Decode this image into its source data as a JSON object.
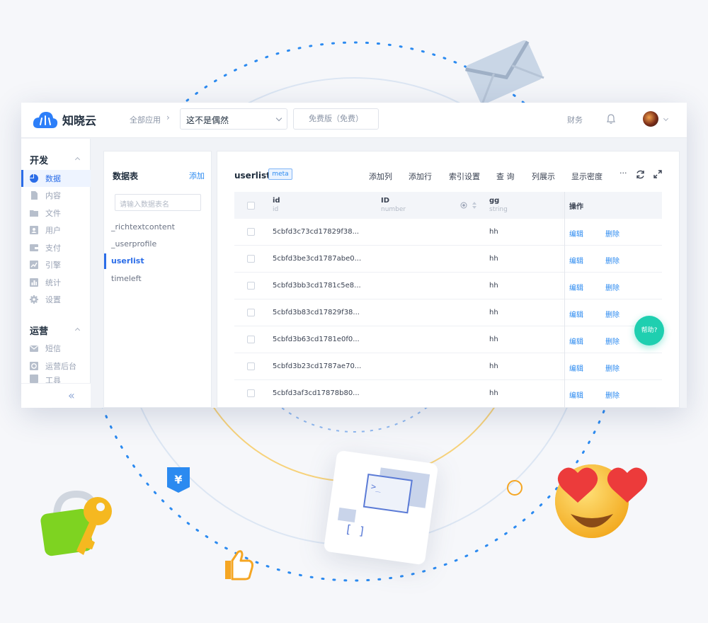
{
  "app": {
    "name": "知晓云"
  },
  "header": {
    "breadcrumb": "全部应用",
    "app_select": "这不是偶然",
    "plan": "免费版（免费）",
    "finance": "财务"
  },
  "sidebar": {
    "groups": [
      {
        "label": "开发",
        "items": [
          {
            "label": "数据",
            "active": true,
            "icon": "pie-chart-icon"
          },
          {
            "label": "内容",
            "icon": "document-icon"
          },
          {
            "label": "文件",
            "icon": "folder-icon"
          },
          {
            "label": "用户",
            "icon": "user-card-icon"
          },
          {
            "label": "支付",
            "icon": "wallet-icon"
          },
          {
            "label": "引擎",
            "icon": "trend-chart-icon"
          },
          {
            "label": "统计",
            "icon": "bar-chart-icon"
          },
          {
            "label": "设置",
            "icon": "gear-icon"
          }
        ]
      },
      {
        "label": "运营",
        "items": [
          {
            "label": "短信",
            "icon": "mail-icon"
          },
          {
            "label": "运营后台",
            "icon": "dashboard-icon"
          },
          {
            "label": "工具",
            "icon": "tool-icon"
          }
        ]
      }
    ],
    "collapse": "«"
  },
  "tables_panel": {
    "title": "数据表",
    "add": "添加",
    "search_placeholder": "请输入数据表名",
    "items": [
      "_richtextcontent",
      "_userprofile",
      "userlist",
      "timeleft"
    ],
    "active": "userlist"
  },
  "main": {
    "title": "userlist",
    "tag": "meta",
    "toolbar": [
      "添加列",
      "添加行",
      "索引设置",
      "查 询",
      "列展示",
      "显示密度"
    ],
    "more": "···",
    "columns": [
      {
        "name": "id",
        "sub": "id"
      },
      {
        "name": "ID",
        "sub": "number"
      },
      {
        "name": "gg",
        "sub": "string"
      },
      {
        "name": "操作",
        "sub": ""
      }
    ],
    "rows": [
      {
        "id": "5cbfd3c73cd17829f38...",
        "gg": "hh"
      },
      {
        "id": "5cbfd3be3cd1787abe0...",
        "gg": "hh"
      },
      {
        "id": "5cbfd3bb3cd1781c5e8...",
        "gg": "hh"
      },
      {
        "id": "5cbfd3b83cd17829f38...",
        "gg": "hh"
      },
      {
        "id": "5cbfd3b63cd1781e0f0...",
        "gg": "hh"
      },
      {
        "id": "5cbfd3b23cd1787ae70...",
        "gg": "hh"
      },
      {
        "id": "5cbfd3af3cd17878b80...",
        "gg": "hh"
      }
    ],
    "edit": "编辑",
    "delete": "删除"
  },
  "help": "帮助?",
  "decor": {
    "yuan_symbol": "¥",
    "bracket_text": "[ ]",
    "prompt_text": ">_"
  },
  "colors": {
    "primary": "#2b6de8",
    "link": "#2b8af0",
    "help": "#1fcfb0",
    "logo": "#2d7ff9"
  }
}
